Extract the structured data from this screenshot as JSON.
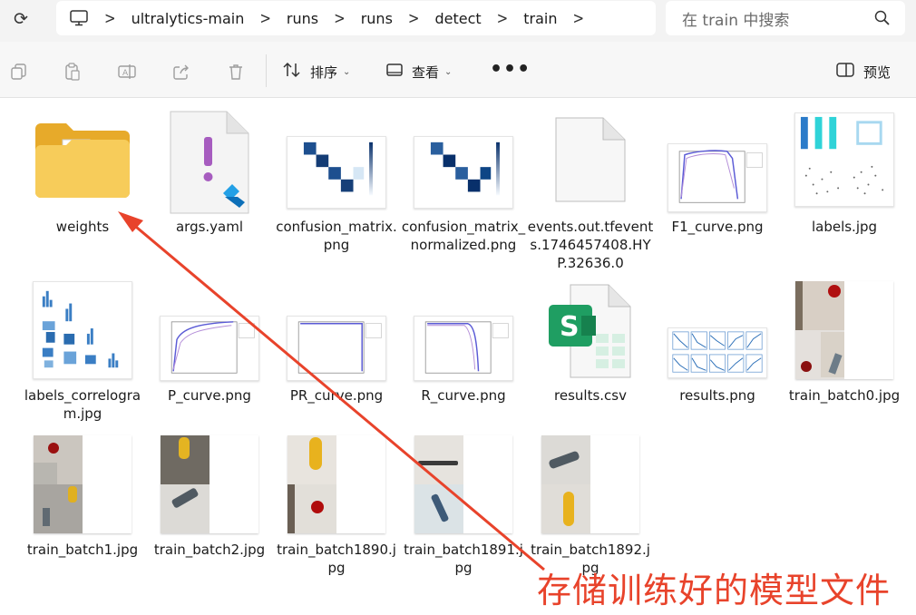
{
  "address_bar": {
    "breadcrumbs": [
      "ultralytics-main",
      "runs",
      "runs",
      "detect",
      "train"
    ],
    "search_placeholder": "在 train 中搜索"
  },
  "toolbar": {
    "sort_label": "排序",
    "view_label": "查看",
    "more_label": "•••",
    "preview_label": "预览"
  },
  "files": [
    {
      "name": "weights",
      "type": "folder"
    },
    {
      "name": "args.yaml",
      "type": "yaml"
    },
    {
      "name": "confusion_matrix.png",
      "type": "image"
    },
    {
      "name": "confusion_matrix_normalized.png",
      "type": "image"
    },
    {
      "name": "events.out.tfevents.1746457408.HYP.32636.0",
      "type": "file"
    },
    {
      "name": "F1_curve.png",
      "type": "image"
    },
    {
      "name": "labels.jpg",
      "type": "image"
    },
    {
      "name": "labels_correlogram.jpg",
      "type": "image"
    },
    {
      "name": "P_curve.png",
      "type": "image"
    },
    {
      "name": "PR_curve.png",
      "type": "image"
    },
    {
      "name": "R_curve.png",
      "type": "image"
    },
    {
      "name": "results.csv",
      "type": "csv"
    },
    {
      "name": "results.png",
      "type": "image"
    },
    {
      "name": "train_batch0.jpg",
      "type": "image"
    },
    {
      "name": "train_batch1.jpg",
      "type": "image"
    },
    {
      "name": "train_batch2.jpg",
      "type": "image"
    },
    {
      "name": "train_batch1890.jpg",
      "type": "image"
    },
    {
      "name": "train_batch1891.jpg",
      "type": "image"
    },
    {
      "name": "train_batch1892.jpg",
      "type": "image"
    }
  ],
  "annotation": {
    "text": "存储训练好的模型文件",
    "color": "#e8432b"
  },
  "colors": {
    "folder": "#f5c445",
    "accent": "#0067c0",
    "csv": "#1f9e62"
  }
}
